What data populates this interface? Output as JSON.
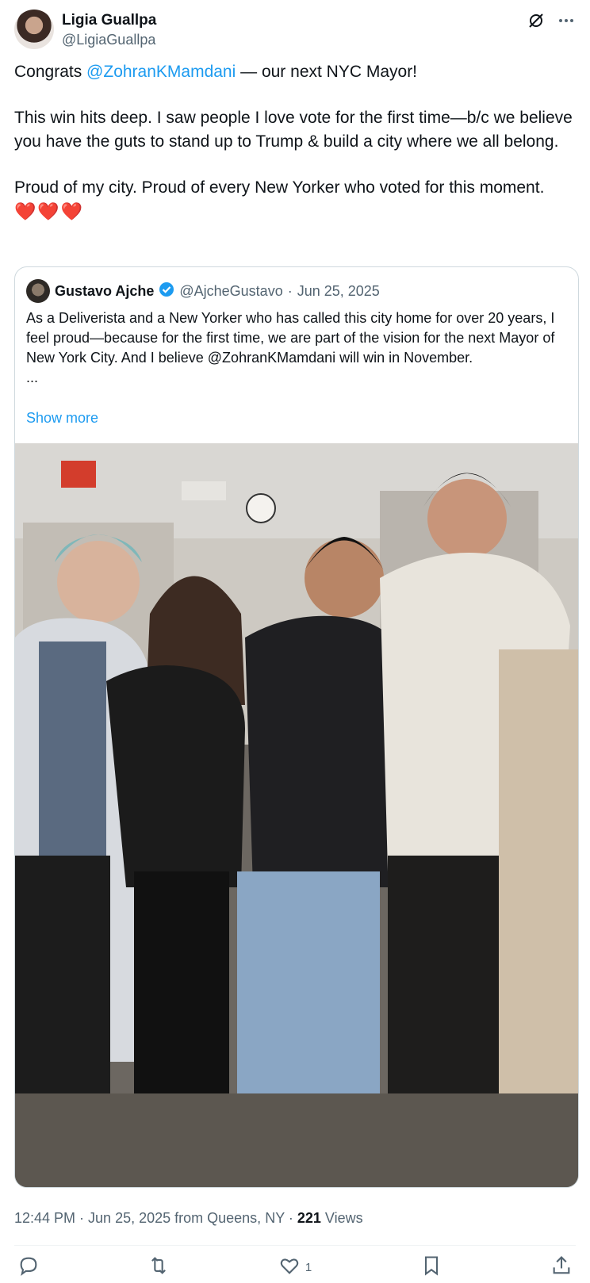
{
  "post": {
    "author_name": "Ligia Guallpa",
    "author_handle": "@LigiaGuallpa",
    "text_line1_pre": "Congrats ",
    "text_mention": "@ZohranKMamdani",
    "text_line1_post": " — our next NYC Mayor!",
    "text_para2": "This win hits deep. I saw people I love vote for the first time—b/c we believe you have the guts to stand up to Trump & build a city where we all belong.",
    "text_para3": "Proud of my city. Proud of every New Yorker who voted for this moment.",
    "hearts": "❤️❤️❤️"
  },
  "quote": {
    "author_name": "Gustavo Ajche",
    "author_handle": "@AjcheGustavo",
    "separator": " · ",
    "date": "Jun 25, 2025",
    "body": "As a Deliverista and a New Yorker who has called this city home for over 20 years, I feel proud—because for the first time, we are part of the vision for the next Mayor of New York City. And I believe @ZohranKMamdani will win in November.",
    "ellipsis": "...",
    "show_more": "Show more"
  },
  "meta": {
    "time": "12:44 PM",
    "dot": " · ",
    "date": "Jun 25, 2025",
    "location": " from Queens, NY",
    "views_count": "221",
    "views_label": " Views"
  },
  "actions": {
    "like_count": "1"
  },
  "colors": {
    "accent": "#1d9bf0",
    "secondary_text": "#536471",
    "heart": "#e0245e"
  }
}
